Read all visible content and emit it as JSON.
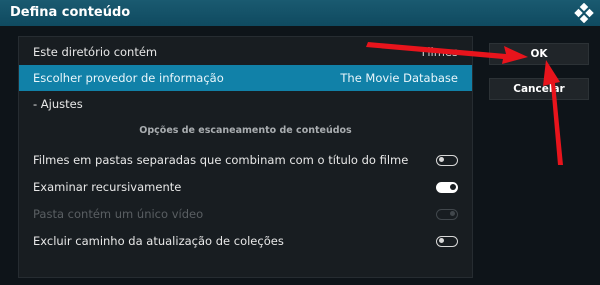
{
  "dialog": {
    "title": "Defina conteúdo"
  },
  "settings": {
    "directory_label": "Este diretório contém",
    "directory_value": "Filmes",
    "provider_label": "Escolher provedor de informação",
    "provider_value": "The Movie Database",
    "adjust_label": "- Ajustes",
    "scan_section_title": "Opções de escaneamento de conteúdos",
    "toggles": [
      {
        "label": "Filmes em pastas separadas que combinam com o título do filme",
        "state": "off"
      },
      {
        "label": "Examinar recursivamente",
        "state": "on"
      },
      {
        "label": "Pasta contém um único vídeo",
        "state": "disabled"
      },
      {
        "label": "Excluir caminho da atualização de coleções",
        "state": "off"
      }
    ]
  },
  "buttons": {
    "ok_label": "OK",
    "cancel_label": "Cancelar"
  },
  "colors": {
    "titlebar": "#12506a",
    "focus": "#1181a8",
    "annotation_arrow": "#e8141c"
  },
  "icons": {
    "logo": "kodi-logo-icon"
  }
}
